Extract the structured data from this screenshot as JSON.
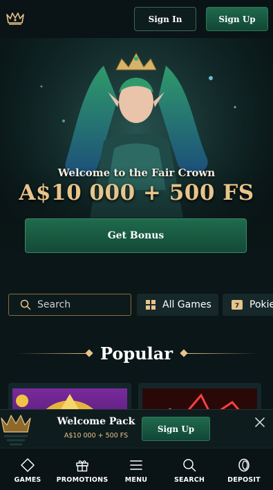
{
  "header": {
    "sign_in_label": "Sign In",
    "sign_up_label": "Sign Up"
  },
  "hero": {
    "welcome_text": "Welcome to the Fair Crown",
    "amount_text": "A$10 000 + 500 FS",
    "cta_label": "Get Bonus"
  },
  "filters": {
    "search_placeholder": "Search",
    "chips": [
      {
        "label": "All Games",
        "icon": "grid-icon"
      },
      {
        "label": "Pokie",
        "icon": "slot-777-icon"
      }
    ]
  },
  "popular": {
    "title": "Popular"
  },
  "welcome_pack": {
    "title": "Welcome Pack",
    "subtitle": "A$10 000 + 500 FS",
    "cta_label": "Sign Up"
  },
  "bottom_nav": [
    {
      "label": "GAMES",
      "icon": "diamond-icon"
    },
    {
      "label": "PROMOTIONS",
      "icon": "gift-icon"
    },
    {
      "label": "MENU",
      "icon": "hamburger-icon"
    },
    {
      "label": "SEARCH",
      "icon": "search-icon"
    },
    {
      "label": "DEPOSIT",
      "icon": "coin-icon"
    }
  ],
  "colors": {
    "accent_gold": "#e8c48a",
    "button_green": "#1f6a4d",
    "background": "#0b1618"
  }
}
